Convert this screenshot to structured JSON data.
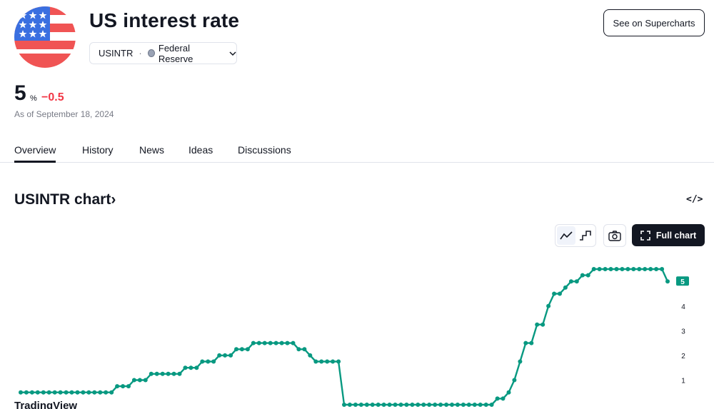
{
  "header": {
    "title": "US interest rate",
    "ticker": "USINTR",
    "source": "Federal Reserve",
    "supercharts_label": "See on Supercharts"
  },
  "quote": {
    "value": "5",
    "unit": "%",
    "change": "−0.5",
    "as_of": "As of September 18, 2024"
  },
  "tabs": [
    {
      "label": "Overview",
      "active": true
    },
    {
      "label": "History",
      "active": false
    },
    {
      "label": "News",
      "active": false
    },
    {
      "label": "Ideas",
      "active": false
    },
    {
      "label": "Discussions",
      "active": false
    }
  ],
  "chart_section": {
    "title": "USINTR chart",
    "title_chevron": "›",
    "embed_label": "</>",
    "full_chart_label": "Full chart",
    "watermark": "TradingView"
  },
  "colors": {
    "line": "#089981",
    "negative": "#f23645",
    "dark": "#131722"
  },
  "chart_data": {
    "type": "line",
    "series": [
      {
        "values": [
          0.5,
          0.5,
          0.5,
          0.5,
          0.5,
          0.5,
          0.5,
          0.5,
          0.5,
          0.5,
          0.5,
          0.5,
          0.5,
          0.5,
          0.5,
          0.5,
          0.5,
          0.75,
          0.75,
          0.75,
          1.0,
          1.0,
          1.0,
          1.25,
          1.25,
          1.25,
          1.25,
          1.25,
          1.25,
          1.5,
          1.5,
          1.5,
          1.75,
          1.75,
          1.75,
          2.0,
          2.0,
          2.0,
          2.25,
          2.25,
          2.25,
          2.5,
          2.5,
          2.5,
          2.5,
          2.5,
          2.5,
          2.5,
          2.5,
          2.25,
          2.25,
          2.0,
          1.75,
          1.75,
          1.75,
          1.75,
          1.75,
          0.0,
          0.0,
          0.0,
          0.0,
          0.0,
          0.0,
          0.0,
          0.0,
          0.0,
          0.0,
          0.0,
          0.0,
          0.0,
          0.0,
          0.0,
          0.0,
          0.0,
          0.0,
          0.0,
          0.0,
          0.0,
          0.0,
          0.0,
          0.0,
          0.0,
          0.0,
          0.0,
          0.25,
          0.25,
          0.5,
          1.0,
          1.75,
          2.5,
          2.5,
          3.25,
          3.25,
          4.0,
          4.5,
          4.5,
          4.75,
          5.0,
          5.0,
          5.25,
          5.25,
          5.5,
          5.5,
          5.5,
          5.5,
          5.5,
          5.5,
          5.5,
          5.5,
          5.5,
          5.5,
          5.5,
          5.5,
          5.5,
          5.0
        ]
      }
    ],
    "last_value_label": "5",
    "y_ticks": [
      1,
      2,
      3,
      4
    ],
    "ylim": [
      0,
      5.5
    ],
    "y_axis_side": "right",
    "grid": false
  }
}
